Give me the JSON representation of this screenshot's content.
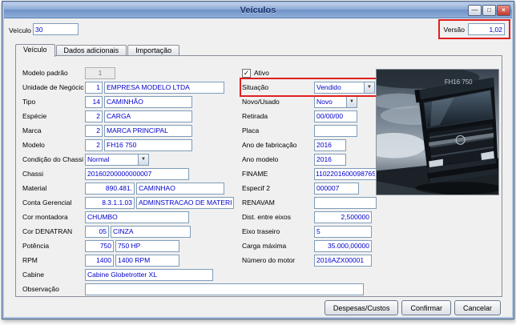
{
  "window": {
    "title": "Veículos",
    "controls": {
      "minimize": "—",
      "maximize": "□",
      "close": "×"
    }
  },
  "header": {
    "veiculo_label": "Veículo",
    "veiculo_value": "30",
    "versao_label": "Versão",
    "versao_value": "1,02"
  },
  "tabs": [
    {
      "label": "Veículo"
    },
    {
      "label": "Dados adicionais"
    },
    {
      "label": "Importação"
    }
  ],
  "fields": {
    "left": [
      {
        "label": "Modelo padrão",
        "code": "1"
      },
      {
        "label": "Unidade de Negócio",
        "code": "1",
        "desc": "EMPRESA MODELO LTDA"
      },
      {
        "label": "Tipo",
        "code": "14",
        "desc": "CAMINHÃO"
      },
      {
        "label": "Espécie",
        "code": "2",
        "desc": "CARGA"
      },
      {
        "label": "Marca",
        "code": "2",
        "desc": "MARCA PRINCIPAL"
      },
      {
        "label": "Modelo",
        "code": "2",
        "desc": "FH16 750"
      },
      {
        "label": "Condição do Chassi",
        "value": "Normal"
      },
      {
        "label": "Chassi",
        "value": "20160200000000007"
      },
      {
        "label": "Material",
        "code": "890.481.",
        "desc": "CAMINHAO"
      },
      {
        "label": "Conta Gerencial",
        "code": "8.3.1.1.03",
        "desc": "ADMINSTRACAO DE MATERIAIS"
      },
      {
        "label": "Cor montadora",
        "value": "CHUMBO"
      },
      {
        "label": "Cor DENATRAN",
        "code": "05",
        "desc": "CINZA"
      },
      {
        "label": "Potência",
        "code": "750",
        "desc": "750 HP"
      },
      {
        "label": "RPM",
        "code": "1400",
        "desc": "1400 RPM"
      },
      {
        "label": "Cabine",
        "value": "Cabine Globetrotter XL"
      },
      {
        "label": "Observação",
        "value": ""
      }
    ],
    "right": [
      {
        "label": "Ativo",
        "checked": true
      },
      {
        "label": "Situação",
        "value": "Vendido"
      },
      {
        "label": "Novo/Usado",
        "value": "Novo"
      },
      {
        "label": "Retirada",
        "value": "00/00/00"
      },
      {
        "label": "Placa",
        "value": ""
      },
      {
        "label": "Ano de fabricação",
        "value": "2016"
      },
      {
        "label": "Ano modelo",
        "value": "2016"
      },
      {
        "label": "FINAME",
        "value": "1102201600098765"
      },
      {
        "label": "Especif 2",
        "value": "000007"
      },
      {
        "label": "RENAVAM",
        "value": ""
      },
      {
        "label": "Dist. entre eixos",
        "value": "2,500000"
      },
      {
        "label": "Eixo traseiro",
        "value": "5"
      },
      {
        "label": "Carga máxima",
        "value": "35.000,00000"
      },
      {
        "label": "Número do motor",
        "value": "2016AZX00001"
      }
    ]
  },
  "truck": {
    "badge": "FH16 750"
  },
  "footer": {
    "buttons": [
      {
        "label": "Despesas/Custos"
      },
      {
        "label": "Confirmar"
      },
      {
        "label": "Cancelar"
      }
    ]
  },
  "icons": {
    "check": "✓",
    "dropdown_arrow": "▼"
  },
  "colors": {
    "value_text": "#0000CC",
    "annotation_red": "#E02020",
    "titlebar_blue": "#7D9CD0"
  }
}
